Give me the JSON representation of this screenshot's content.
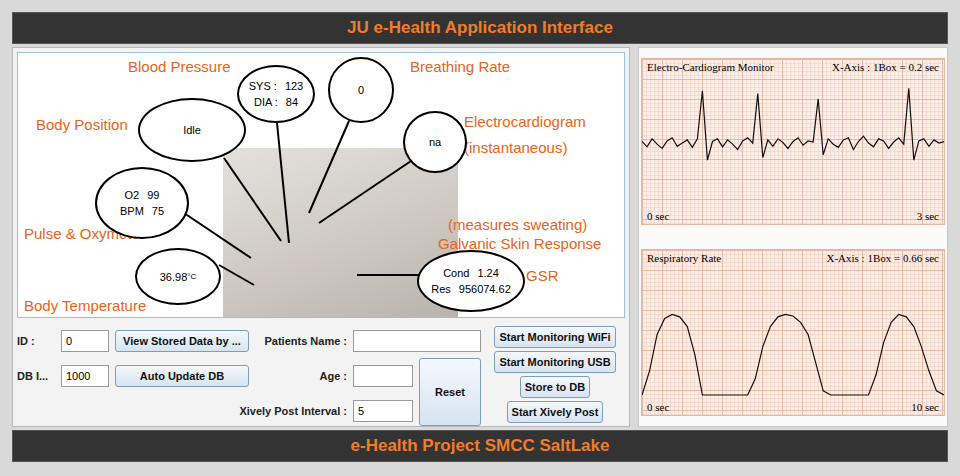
{
  "header": {
    "title": "JU e-Health Application Interface"
  },
  "footer": {
    "title": "e-Health Project SMCC SaltLake"
  },
  "canvas": {
    "labels": [
      "Blood Pressure",
      "Breathing Rate",
      "Body Position",
      "Electrocardiogram",
      "(instantaneous)",
      "Pulse & Oxymeter",
      "(measures sweating)",
      "Galvanic Skin Response",
      "GSR",
      "Body Temperature"
    ],
    "bubbles": [
      {
        "fields": [
          {
            "label": "SYS :",
            "value": "123"
          },
          {
            "label": "DIA :",
            "value": "84"
          }
        ]
      },
      {
        "fields": [
          {
            "value": "0"
          }
        ]
      },
      {
        "fields": [
          {
            "value": "Idle"
          }
        ]
      },
      {
        "fields": [
          {
            "value": "na"
          }
        ]
      },
      {
        "fields": [
          {
            "label": "O2",
            "value": "99"
          },
          {
            "label": "BPM",
            "value": "75"
          }
        ]
      },
      {
        "fields": [
          {
            "value": "36.98",
            "unit": "°C"
          }
        ]
      },
      {
        "fields": [
          {
            "label": "Cond",
            "value": "1.24"
          },
          {
            "label": "Res",
            "value": "956074.62"
          }
        ]
      }
    ]
  },
  "form": {
    "id": {
      "label": "ID :",
      "value": "0"
    },
    "db": {
      "label": "DB I...",
      "value": "1000"
    },
    "patient_name": {
      "label": "Patients Name :",
      "value": ""
    },
    "age": {
      "label": "Age :",
      "value": ""
    },
    "xively_interval": {
      "label": "Xively Post Interval :",
      "value": "5"
    },
    "view_button": "View Stored Data by ...",
    "auto_update_button": "Auto Update DB",
    "reset_button": "Reset",
    "actions": [
      "Start Monitoring WiFi",
      "Start Monitoring USB",
      "Store to DB",
      "Start Xively Post"
    ]
  },
  "charts": [
    {
      "title": "Electro-Cardiogram Monitor",
      "x_axis": "X-Axis : 1Box = 0.2 sec",
      "start": "0 sec",
      "end": "3 sec",
      "values": [
        0.05,
        -0.05,
        0.1,
        0,
        -0.08,
        0.06,
        0.12,
        -0.04,
        0.02,
        0.08,
        -0.06,
        0.1,
        1.0,
        -0.3,
        0.05,
        0.1,
        -0.05,
        0.08,
        0,
        -0.1,
        0.06,
        0.12,
        0.02,
        0.95,
        -0.25,
        0.08,
        -0.04,
        0.1,
        0.03,
        -0.08,
        0.05,
        0.12,
        -0.02,
        0.06,
        0.04,
        0.85,
        -0.2,
        0.1,
        0,
        -0.06,
        0.08,
        0.12,
        -0.1,
        0.05,
        0.15,
        0.02,
        -0.05,
        0.1,
        0.06,
        -0.08,
        0.04,
        0.12,
        0,
        1.05,
        -0.3,
        0.06,
        0.1,
        -0.04,
        0.08,
        0.02,
        0.05
      ]
    },
    {
      "title": "Respiratory Rate",
      "x_axis": "X-Axis : 1Box = 0.66 sec",
      "start": "0 sec",
      "end": "10 sec",
      "values": [
        0,
        0.3,
        0.75,
        0.95,
        1,
        0.97,
        0.85,
        0.5,
        0,
        0,
        0,
        0,
        0,
        0,
        0,
        0.2,
        0.6,
        0.85,
        0.97,
        1,
        0.98,
        0.9,
        0.75,
        0.4,
        0.05,
        0,
        0,
        0,
        0,
        0,
        0,
        0.25,
        0.65,
        0.9,
        1,
        0.97,
        0.85,
        0.6,
        0.3,
        0.05,
        0
      ]
    }
  ]
}
